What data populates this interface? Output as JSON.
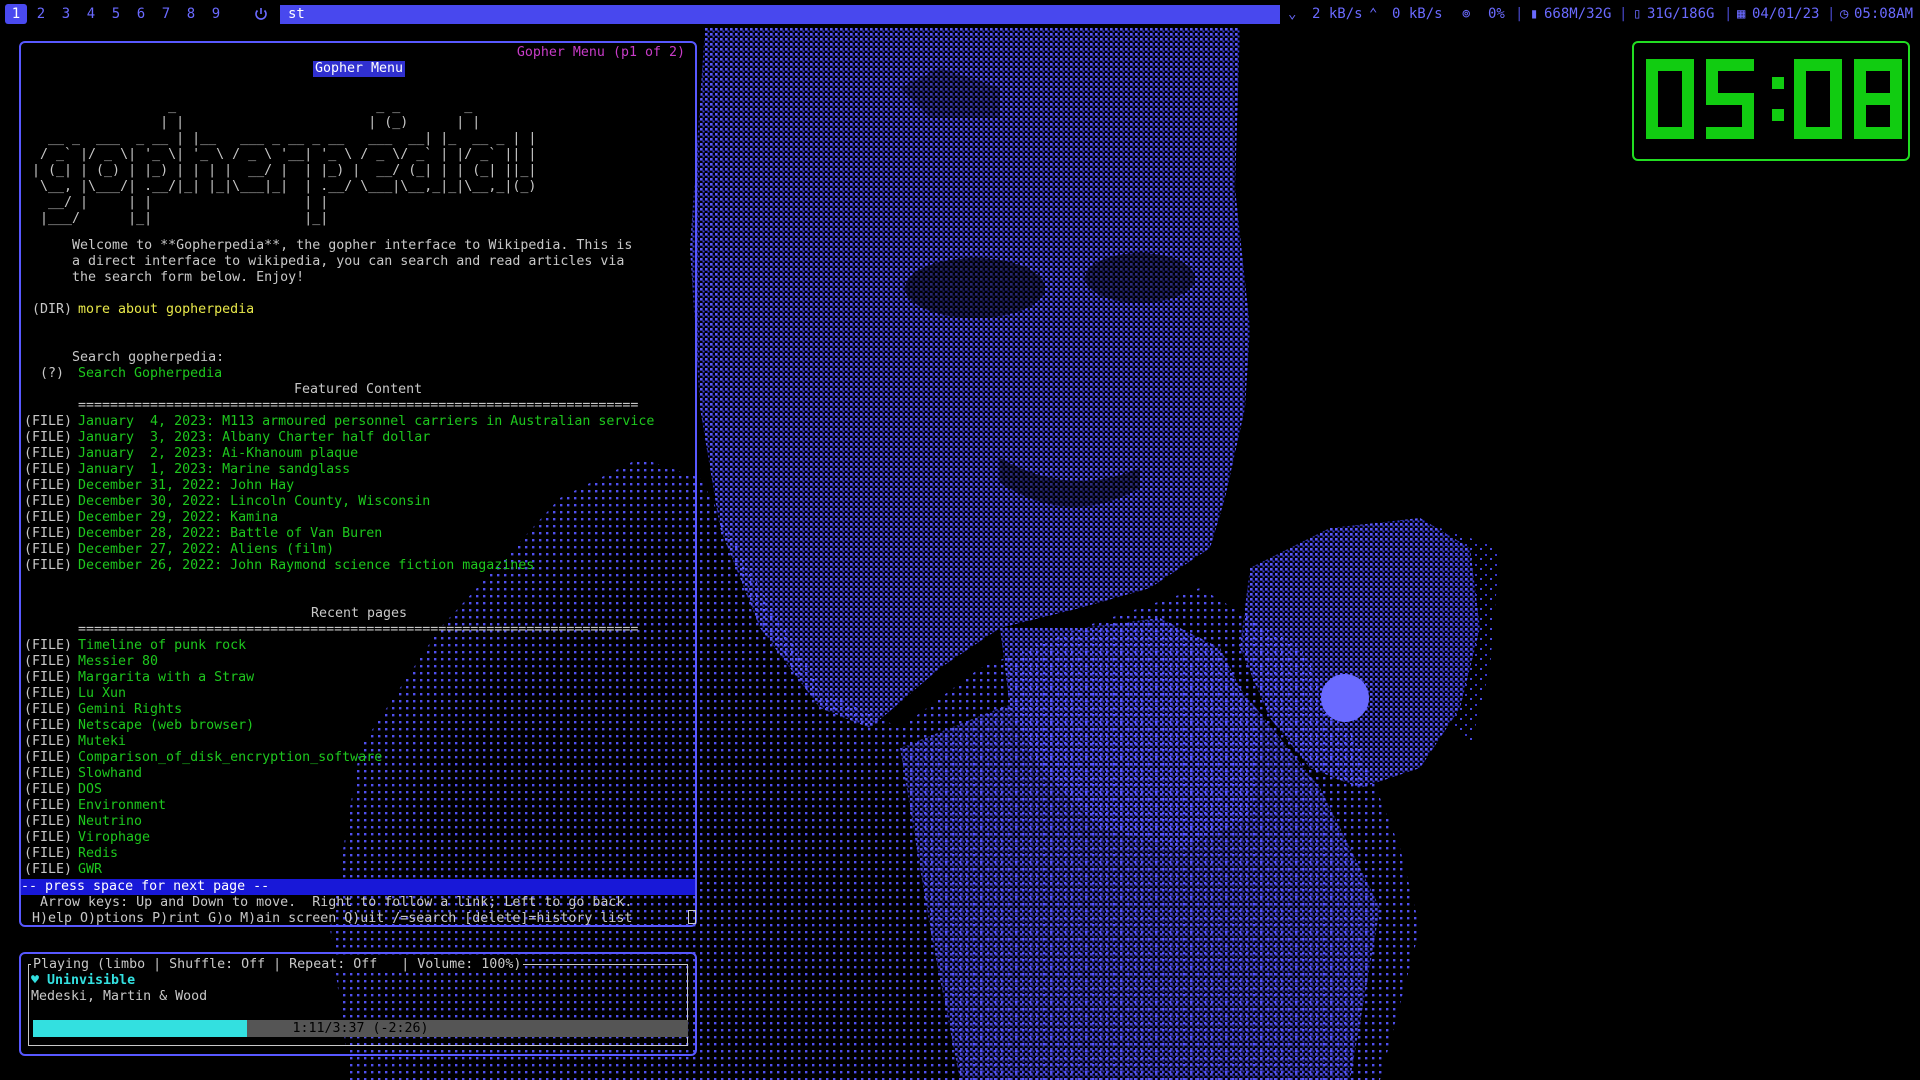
{
  "topbar": {
    "workspaces": [
      "1",
      "2",
      "3",
      "4",
      "5",
      "6",
      "7",
      "8",
      "9"
    ],
    "active_workspace": "1",
    "window_title": "st",
    "net_down": "2 kB/s",
    "net_up": "0 kB/s",
    "cpu": "0%",
    "memory": "668M/32G",
    "disk": "31G/186G",
    "date": "04/01/23",
    "time": "05:08AM"
  },
  "gopher": {
    "page_status": "Gopher Menu (p1 of 2)",
    "menu_title": "Gopher Menu",
    "ascii_logo": [
      "                  _                         _ _        _",
      "                 | |                       | (_)      | |",
      "   __ _  ___  _ __ | |__   ___ _ __ _ __   ___  __| |_  __ _ | |",
      "  / _` |/ _ \\| '_ \\| '_ \\ / _ \\ '__| '_ \\ / _ \\/ _` | |/ _` || |",
      " | (_| | (_) | |_) | | | |  __/ |  | |_) |  __/ (_| | | (_| ||_|",
      "  \\__, |\\___/| .__/|_| |_|\\___|_|  | .__/ \\___|\\__,_|_|\\__,_|(_)",
      "   __/ |     | |                   | |",
      "  |___/      |_|                   |_|"
    ],
    "welcome": [
      "      Welcome to **Gopherpedia**, the gopher interface to Wikipedia. This is",
      "      a direct interface to wikipedia, you can search and read articles via",
      "      the search form below. Enjoy!"
    ],
    "dir_tag": " (DIR)",
    "dir_link": "more about gopherpedia",
    "search_prompt": "      Search gopherpedia:",
    "search_tag": "  (?)",
    "search_link": "Search Gopherpedia",
    "featured_heading": "Featured Content",
    "rule": "======================================================================",
    "file_tag": "(FILE)",
    "featured": [
      "January  4, 2023: M113 armoured personnel carriers in Australian service",
      "January  3, 2023: Albany Charter half dollar",
      "January  2, 2023: Ai-Khanoum plaque",
      "January  1, 2023: Marine sandglass",
      "December 31, 2022: John Hay",
      "December 30, 2022: Lincoln County, Wisconsin",
      "December 29, 2022: Kamina",
      "December 28, 2022: Battle of Van Buren",
      "December 27, 2022: Aliens (film)",
      "December 26, 2022: John Raymond science fiction magazines"
    ],
    "recent_heading": "Recent pages",
    "recent": [
      "Timeline of punk rock",
      "Messier 80",
      "Margarita with a Straw",
      "Lu Xun",
      "Gemini Rights",
      "Netscape (web browser)",
      "Muteki",
      "Comparison_of_disk_encryption_software",
      "Slowhand",
      "DOS",
      "Environment",
      "Neutrino",
      "Virophage",
      "Redis",
      "GWR"
    ],
    "next_page_hint": "-- press space for next page --",
    "help_line_1": "  Arrow keys: Up and Down to move.  Right to follow a link; Left to go back.",
    "help_line_2": " H)elp O)ptions P)rint G)o M)ain screen Q)uit /=search [delete]=history list"
  },
  "player": {
    "status": "Playing (limbo | Shuffle: Off | Repeat: Off   | Volume: 100%)",
    "track": "♥ Uninvisible",
    "artist": "Medeski, Martin & Wood",
    "progress_text": "1:11/3:37 (-2:26)",
    "progress_fraction": 0.327
  },
  "clock": {
    "time": "05:08",
    "color": "#11cc11"
  },
  "colors": {
    "accent": "#5858ff",
    "link": "#1ec81e",
    "dir": "#e8e84a",
    "cyan": "#33e0e0"
  }
}
